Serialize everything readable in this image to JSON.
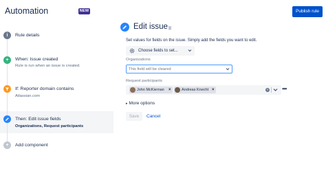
{
  "header": {
    "title": "Automation",
    "badge": "NEW",
    "publish_label": "Publish rule"
  },
  "steps": [
    {
      "label": "Rule details",
      "sub": "",
      "icon": "info-icon",
      "color": "#6b778c"
    },
    {
      "label": "When: Issue created",
      "sub": "Rule is run when an issue is created.",
      "icon": "plus-icon",
      "color": "#36b37e"
    },
    {
      "label": "If: Reporter domain contains",
      "sub": "Atlassian.com",
      "icon": "filter-icon",
      "color": "#ff991f"
    },
    {
      "label": "Then: Edit issue fields",
      "sub": "Organizations, Request participants",
      "icon": "pencil-icon",
      "color": "#2684ff"
    },
    {
      "label": "Add component",
      "sub": "",
      "icon": "plus-icon",
      "color": "#c1c7d0"
    }
  ],
  "main": {
    "title": "Edit issue",
    "description": "Set values for fields on the issue. Simply add the fields you want to edit.",
    "choose_fields": "Choose fields to set...",
    "org_label": "Organizations",
    "org_placeholder": "This field will be cleared",
    "participants_label": "Request participants",
    "participants": [
      "John McKiernan",
      "Andreas Knecht"
    ],
    "more_options": "More options",
    "save_label": "Save",
    "cancel_label": "Cancel"
  },
  "colors": {
    "accent": "#0052cc",
    "focus": "#4c9aff",
    "badge": "#403294"
  }
}
